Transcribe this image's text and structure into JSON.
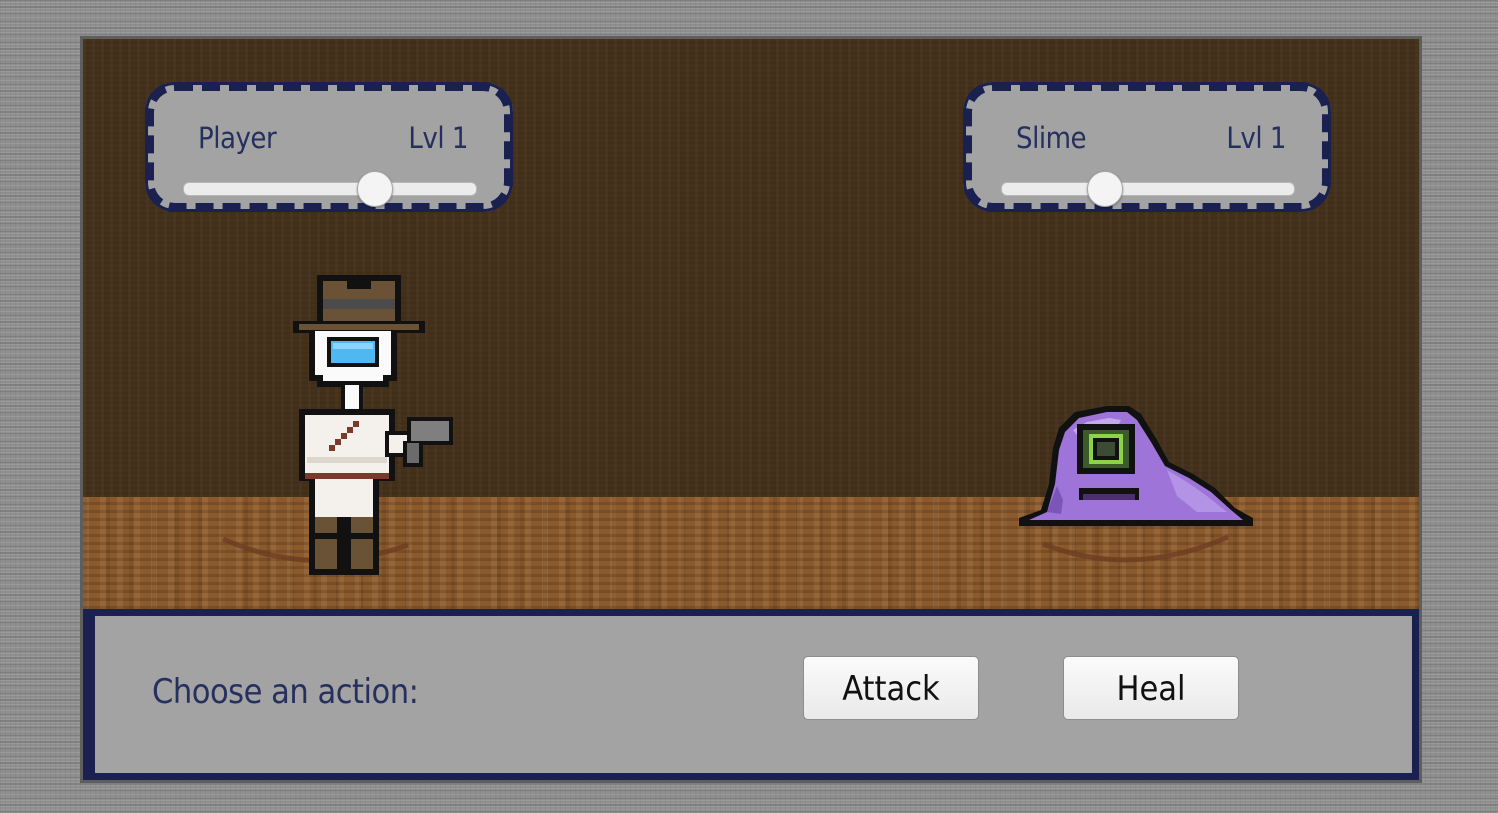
{
  "player": {
    "name": "Player",
    "level_label": "Lvl 1",
    "hp_fraction": 0.65
  },
  "enemy": {
    "name": "Slime",
    "level_label": "Lvl 1",
    "hp_fraction": 0.35
  },
  "action_bar": {
    "prompt": "Choose an action:",
    "attack_label": "Attack",
    "heal_label": "Heal"
  },
  "colors": {
    "panel_border": "#1a2150",
    "panel_fill": "#a3a3a3",
    "text": "#26305e",
    "slime": "#9e74d8"
  },
  "icons": {
    "player_sprite": "cowboy-hat-gunslinger-sprite",
    "enemy_sprite": "one-eyed-purple-slime-sprite"
  }
}
